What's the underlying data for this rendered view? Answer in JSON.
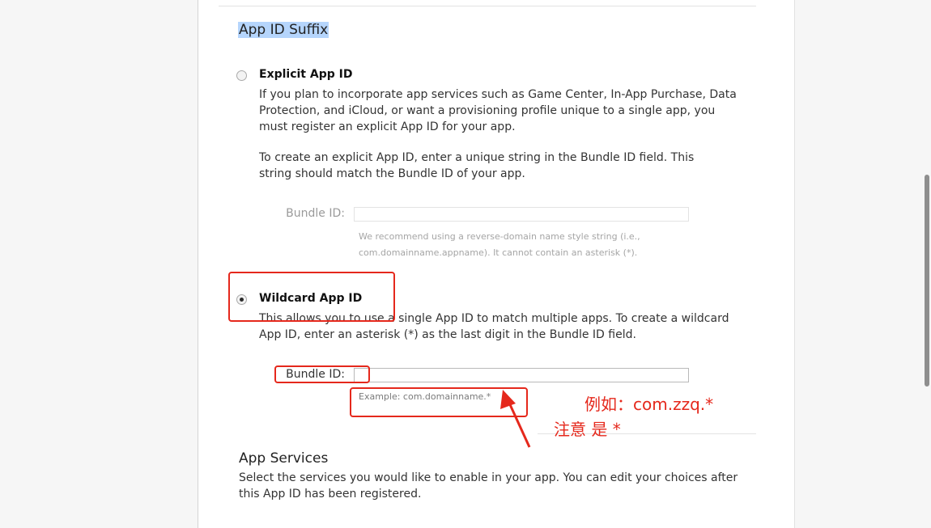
{
  "suffix_section": {
    "title": "App ID Suffix"
  },
  "explicit": {
    "label": "Explicit App ID",
    "description": "If you plan to incorporate app services such as Game Center, In-App Purchase, Data Protection, and iCloud, or want a provisioning profile unique to a single app, you must register an explicit App ID for your app.",
    "instruction": "To create an explicit App ID, enter a unique string in the Bundle ID field. This string should match the Bundle ID of your app.",
    "bundle_label": "Bundle ID:",
    "bundle_value": "",
    "hint": "We recommend using a reverse-domain name style string (i.e., com.domainname.appname). It cannot contain an asterisk (*).",
    "selected": false
  },
  "wildcard": {
    "label": "Wildcard App ID",
    "description": "This allows you to use a single App ID to match multiple apps. To create a wildcard App ID, enter an asterisk (*) as the last digit in the Bundle ID field.",
    "bundle_label": "Bundle ID:",
    "bundle_value": "",
    "example": "Example: com.domainname.*",
    "selected": true
  },
  "annotation": {
    "line1": "例如：com.zzq.*",
    "line2": "注意 是 *",
    "color": "#e5281c"
  },
  "services_section": {
    "title": "App Services",
    "description": "Select the services you would like to enable in your app. You can edit your choices after this App ID has been registered."
  }
}
